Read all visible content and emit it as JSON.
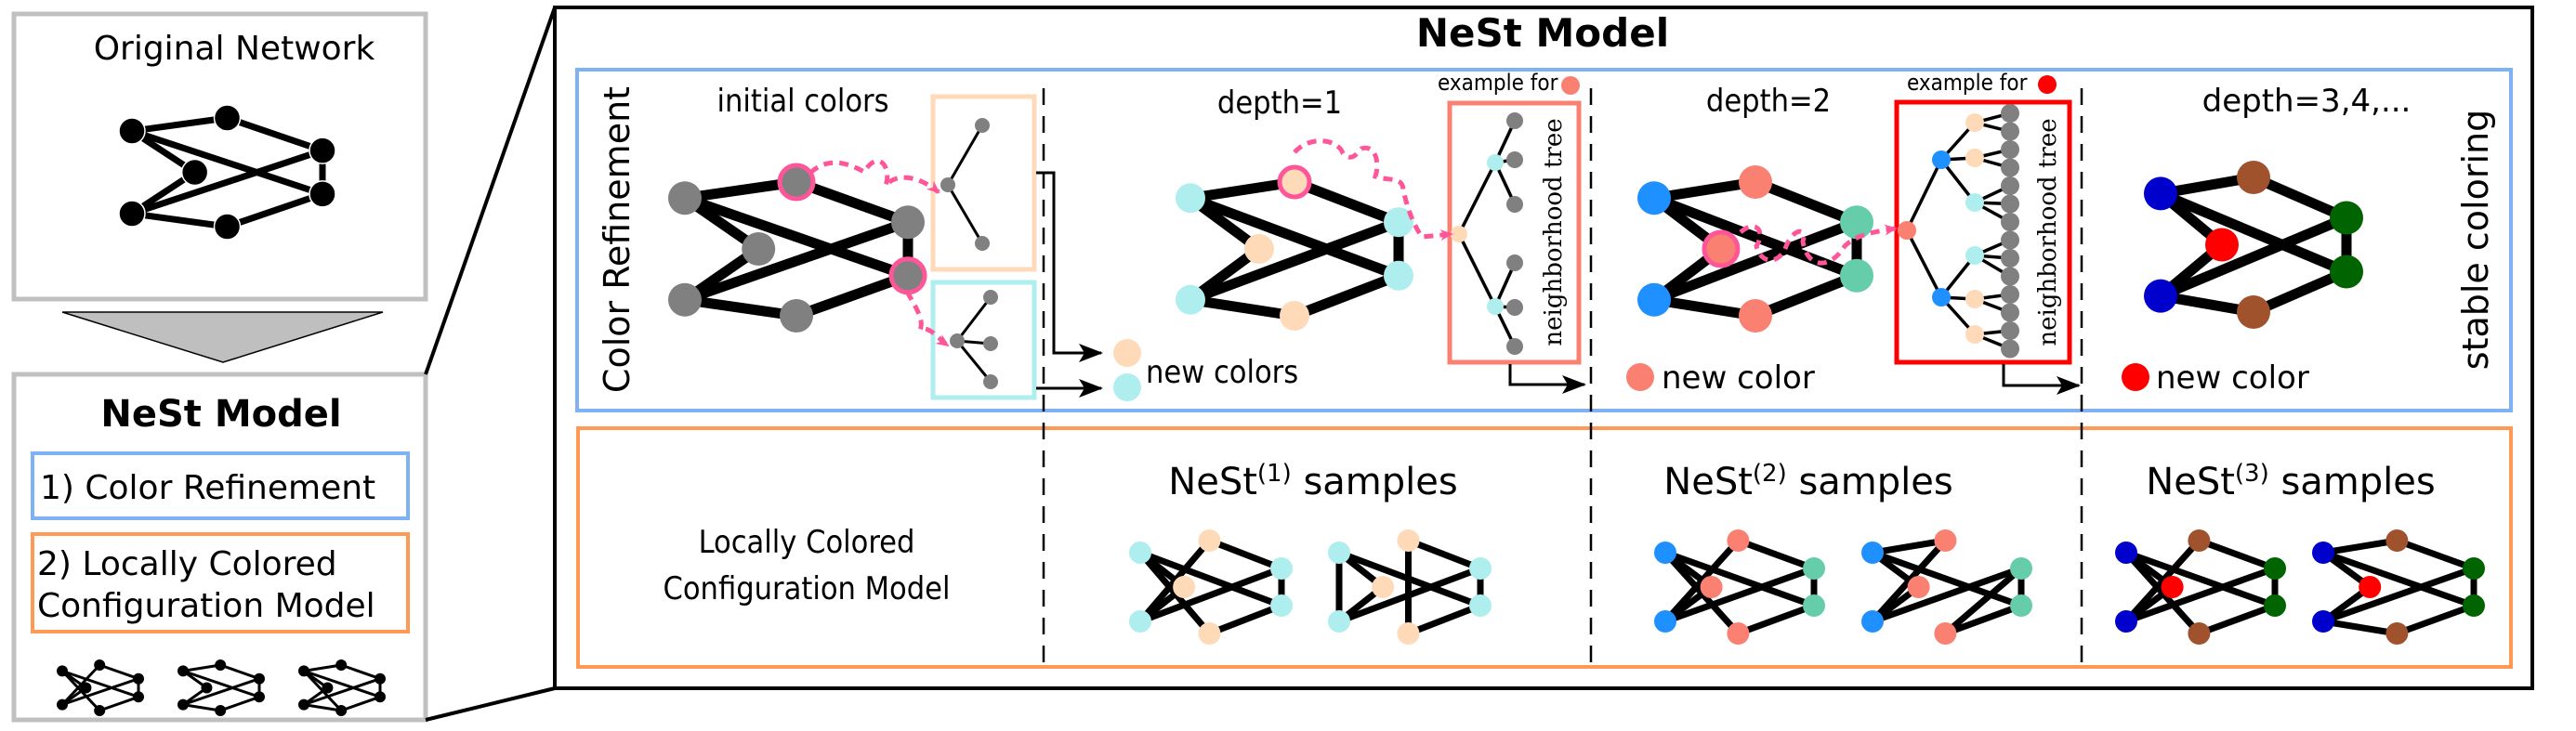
{
  "colors": {
    "gray": "#808080",
    "black": "#000000",
    "peach": "#FFDAB9",
    "cyan": "#AFEEEE",
    "salmon": "#FA8072",
    "dodger_blue": "#1E90FF",
    "medium_aquamarine": "#66CDAA",
    "red": "#FF0000",
    "medium_blue": "#0000CD",
    "sienna": "#A0522D",
    "dark_green": "#006400",
    "highlight_pink": "#FF5599",
    "panel_gray": "#C0C0C0",
    "blue_frame": "#7FB2F5",
    "orange_frame": "#FF9955"
  },
  "left_panel": {
    "original_title": "Original Network",
    "model_title": "NeSt Model",
    "step1": "1) Color Refinement",
    "step2_line1": "2) Locally Colored",
    "step2_line2": "Configuration Model"
  },
  "main": {
    "title": "NeSt Model",
    "color_refinement_label": "Color Refinement",
    "stable_coloring_label": "stable coloring",
    "columns": [
      {
        "header": "initial colors",
        "legend": "new colors",
        "node_colors": [
          "gray",
          "gray",
          "gray",
          "gray",
          "gray",
          "gray",
          "gray"
        ],
        "highlighted": [
          1,
          6
        ]
      },
      {
        "header": "depth=1",
        "legend": "new color",
        "example_label": "example for",
        "example_color": "salmon",
        "tree_label": "neighborhood tree",
        "node_colors": [
          "cyan",
          "peach",
          "peach",
          "cyan",
          "peach",
          "cyan",
          "cyan"
        ],
        "highlighted": [
          1
        ]
      },
      {
        "header": "depth=2",
        "legend": "new color",
        "example_label": "example for",
        "example_color": "red",
        "tree_label": "neighborhood tree",
        "node_colors": [
          "dodger_blue",
          "salmon",
          "salmon",
          "dodger_blue",
          "salmon",
          "medium_aquamarine",
          "medium_aquamarine"
        ],
        "highlighted": [
          2
        ]
      },
      {
        "header": "depth=3,4,...",
        "legend": "new color",
        "node_colors": [
          "medium_blue",
          "sienna",
          "red",
          "medium_blue",
          "sienna",
          "dark_green",
          "dark_green"
        ],
        "highlighted": []
      }
    ],
    "lccm_label_line1": "Locally Colored",
    "lccm_label_line2": "Configuration Model",
    "samples": [
      {
        "prefix": "NeSt",
        "superscript": "(1)",
        "suffix": "samples",
        "palette": [
          "cyan",
          "peach",
          "peach",
          "cyan",
          "peach",
          "cyan",
          "cyan"
        ]
      },
      {
        "prefix": "NeSt",
        "superscript": "(2)",
        "suffix": "samples",
        "palette": [
          "dodger_blue",
          "salmon",
          "salmon",
          "dodger_blue",
          "salmon",
          "medium_aquamarine",
          "medium_aquamarine"
        ]
      },
      {
        "prefix": "NeSt",
        "superscript": "(3)",
        "suffix": "samples",
        "palette": [
          "medium_blue",
          "sienna",
          "red",
          "medium_blue",
          "sienna",
          "dark_green",
          "dark_green"
        ]
      }
    ]
  },
  "graph": {
    "nodes": [
      "A",
      "B",
      "C",
      "D",
      "E",
      "F",
      "G"
    ],
    "edges": [
      [
        "A",
        "B"
      ],
      [
        "A",
        "C"
      ],
      [
        "A",
        "G"
      ],
      [
        "D",
        "C"
      ],
      [
        "D",
        "F"
      ],
      [
        "D",
        "E"
      ],
      [
        "B",
        "F"
      ],
      [
        "F",
        "G"
      ],
      [
        "E",
        "G"
      ]
    ],
    "sample_edges_variant1": [
      [
        "A",
        "C"
      ],
      [
        "A",
        "G"
      ],
      [
        "A",
        "E"
      ],
      [
        "D",
        "C"
      ],
      [
        "D",
        "F"
      ],
      [
        "D",
        "B"
      ],
      [
        "B",
        "F"
      ],
      [
        "F",
        "G"
      ],
      [
        "E",
        "G"
      ]
    ],
    "sample_edges_variant2": [
      [
        "A",
        "C"
      ],
      [
        "A",
        "G"
      ],
      [
        "A",
        "D"
      ],
      [
        "D",
        "C"
      ],
      [
        "D",
        "F"
      ],
      [
        "B",
        "E"
      ],
      [
        "B",
        "F"
      ],
      [
        "F",
        "G"
      ],
      [
        "E",
        "G"
      ]
    ],
    "sample_edges_variant3": [
      [
        "A",
        "B"
      ],
      [
        "A",
        "C"
      ],
      [
        "A",
        "G"
      ],
      [
        "D",
        "C"
      ],
      [
        "D",
        "F"
      ],
      [
        "D",
        "B"
      ],
      [
        "E",
        "F"
      ],
      [
        "F",
        "G"
      ],
      [
        "E",
        "G"
      ]
    ]
  }
}
